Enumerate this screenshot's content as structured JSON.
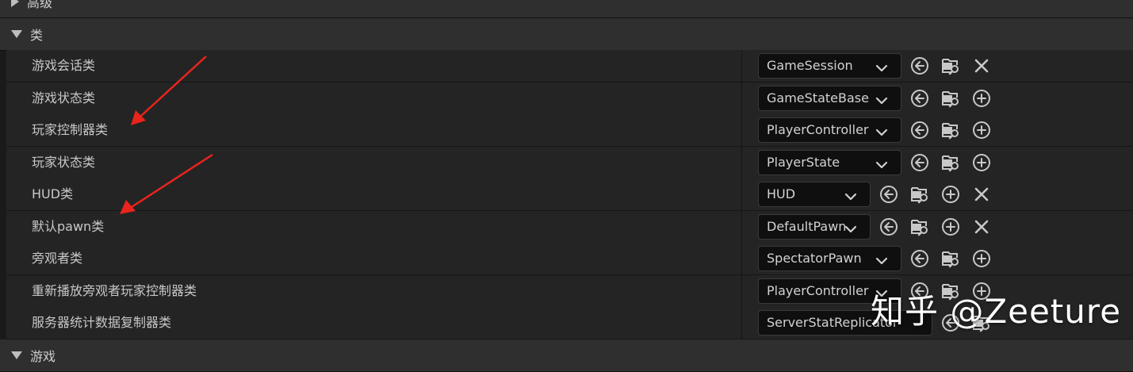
{
  "sections": {
    "advanced": {
      "title": "高级"
    },
    "classes": {
      "title": "类"
    },
    "game": {
      "title": "游戏"
    }
  },
  "rows": [
    {
      "label": "游戏会话类",
      "value": "GameSession"
    },
    {
      "label": "游戏状态类",
      "value": "GameStateBase"
    },
    {
      "label": "玩家控制器类",
      "value": "PlayerController"
    },
    {
      "label": "玩家状态类",
      "value": "PlayerState"
    },
    {
      "label": "HUD类",
      "value": "HUD"
    },
    {
      "label": "默认pawn类",
      "value": "DefaultPawn"
    },
    {
      "label": "旁观者类",
      "value": "SpectatorPawn"
    },
    {
      "label": "重新播放旁观者玩家控制器类",
      "value": "PlayerController"
    },
    {
      "label": "服务器统计数据复制器类",
      "value": "ServerStatReplicator"
    }
  ],
  "watermark": "知乎 @Zeeture",
  "colors": {
    "annotation_arrow": "#e8241c",
    "background": "#1a1a1a",
    "row": "#242424",
    "header": "#2f2f2f"
  }
}
